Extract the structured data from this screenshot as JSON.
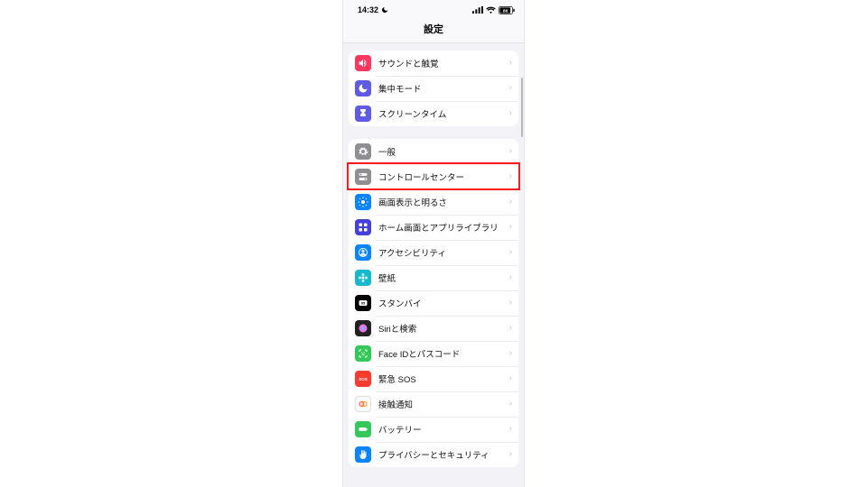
{
  "statusbar": {
    "time": "14:32",
    "battery_pct": "86"
  },
  "header": {
    "title": "設定"
  },
  "groups": [
    {
      "rows": [
        {
          "id": "sounds",
          "label": "サウンドと触覚",
          "icon": "speaker",
          "bg": "#ff3860"
        },
        {
          "id": "focus",
          "label": "集中モード",
          "icon": "moon",
          "bg": "#5e5ce6"
        },
        {
          "id": "screentime",
          "label": "スクリーンタイム",
          "icon": "hourglass",
          "bg": "#5e5ce6"
        }
      ]
    },
    {
      "rows": [
        {
          "id": "general",
          "label": "一般",
          "icon": "gear",
          "bg": "#8e8e93"
        },
        {
          "id": "control-center",
          "label": "コントロールセンター",
          "icon": "switches",
          "bg": "#8e8e93",
          "highlight": true
        },
        {
          "id": "display",
          "label": "画面表示と明るさ",
          "icon": "sun",
          "bg": "#0a84ff"
        },
        {
          "id": "home-screen",
          "label": "ホーム画面とアプリライブラリ",
          "icon": "grid",
          "bg": "#4540d9"
        },
        {
          "id": "accessibility",
          "label": "アクセシビリティ",
          "icon": "person",
          "bg": "#0a84ff"
        },
        {
          "id": "wallpaper",
          "label": "壁紙",
          "icon": "flower",
          "bg": "#16b9d0"
        },
        {
          "id": "standby",
          "label": "スタンバイ",
          "icon": "standby",
          "bg": "#000000"
        },
        {
          "id": "siri",
          "label": "Siriと検索",
          "icon": "siri",
          "bg": "#222222"
        },
        {
          "id": "faceid",
          "label": "Face IDとパスコード",
          "icon": "faceid",
          "bg": "#34c759"
        },
        {
          "id": "sos",
          "label": "緊急 SOS",
          "icon": "sos",
          "bg": "#ff3b30"
        },
        {
          "id": "exposure",
          "label": "接触通知",
          "icon": "exposure",
          "bg": "#ffffff",
          "border": true
        },
        {
          "id": "battery",
          "label": "バッテリー",
          "icon": "battery",
          "bg": "#34c759"
        },
        {
          "id": "privacy",
          "label": "プライバシーとセキュリティ",
          "icon": "hand",
          "bg": "#0a84ff"
        }
      ]
    }
  ]
}
